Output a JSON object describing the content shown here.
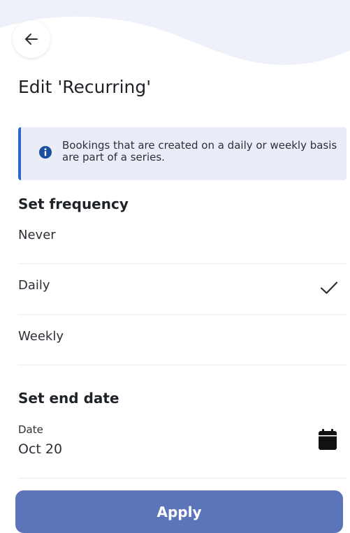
{
  "header": {
    "back_icon": "arrow-left-icon",
    "title": "Edit 'Recurring'"
  },
  "info_banner": {
    "icon": "info-icon",
    "text": "Bookings that are created on a daily or weekly basis are part of a series."
  },
  "frequency": {
    "title": "Set frequency",
    "options": [
      {
        "label": "Never",
        "selected": false
      },
      {
        "label": "Daily",
        "selected": true
      },
      {
        "label": "Weekly",
        "selected": false
      }
    ]
  },
  "end_date": {
    "title": "Set end date",
    "field_label": "Date",
    "field_value": "Oct 20",
    "calendar_icon": "calendar-icon"
  },
  "apply_button": {
    "label": "Apply"
  },
  "colors": {
    "accent": "#2f64c8",
    "banner_background": "#e8edf8",
    "apply_button": "#5b75b8",
    "wave_background": "#eef1fa"
  }
}
